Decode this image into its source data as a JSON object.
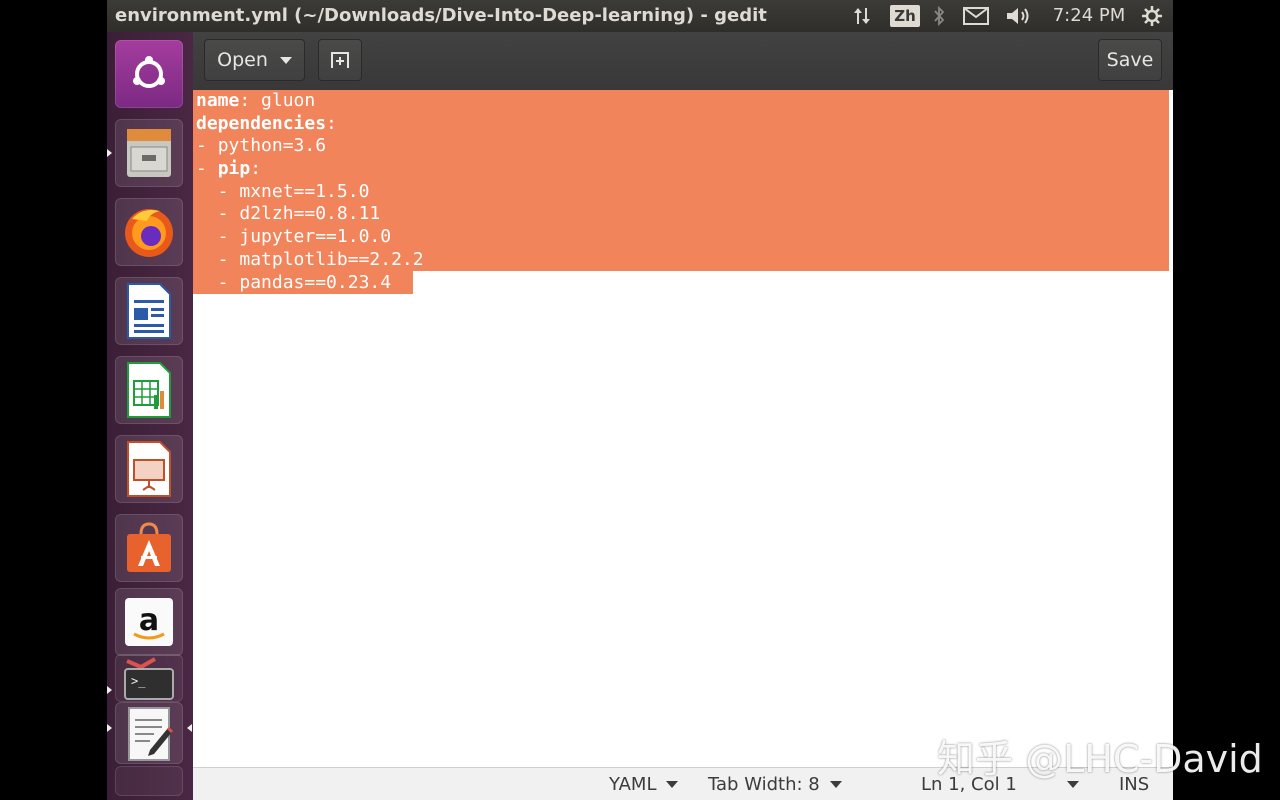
{
  "window": {
    "title": "environment.yml (~/Downloads/Dive-Into-Deep-learning) - gedit"
  },
  "top_panel": {
    "input_method": "Zh",
    "clock": "7:24 PM",
    "icons": [
      "network-updown-icon",
      "input-method-icon",
      "bluetooth-icon",
      "mail-icon",
      "volume-icon",
      "system-gear-icon"
    ]
  },
  "launcher": {
    "items": [
      "ubuntu-dash",
      "files",
      "firefox",
      "libreoffice-writer",
      "libreoffice-calc",
      "libreoffice-impress",
      "ubuntu-software",
      "amazon",
      "system-settings",
      "terminal",
      "text-editor"
    ]
  },
  "toolbar": {
    "open_label": "Open",
    "save_label": "Save"
  },
  "editor": {
    "lines": [
      {
        "key": "name",
        "rest": ": gluon"
      },
      {
        "key": "dependencies",
        "rest": ":"
      },
      {
        "prefix": "- ",
        "plain": "python=3.6"
      },
      {
        "prefix": "- ",
        "key": "pip",
        "rest": ":"
      },
      {
        "prefix": "  - ",
        "plain": "mxnet==1.5.0"
      },
      {
        "prefix": "  - ",
        "plain": "d2lzh==0.8.11"
      },
      {
        "prefix": "  - ",
        "plain": "jupyter==1.0.0"
      },
      {
        "prefix": "  - ",
        "plain": "matplotlib==2.2.2"
      },
      {
        "prefix": "  - ",
        "plain": "pandas==0.23.4"
      }
    ],
    "selection_color": "#f2845b"
  },
  "status_bar": {
    "language": "YAML",
    "tab_width": "Tab Width: 8",
    "cursor": "Ln 1, Col 1",
    "mode": "INS"
  },
  "watermark": "知乎 @LHC-David"
}
